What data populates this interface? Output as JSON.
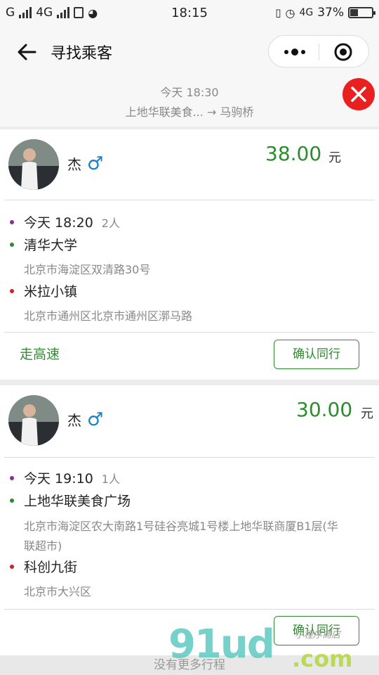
{
  "status_bar": {
    "carrier1": "G",
    "carrier2": "4G",
    "time": "18:15",
    "network": "4G",
    "battery": "37%",
    "battery_level": 0.37
  },
  "nav": {
    "title": "寻找乘客",
    "back_icon": "back-arrow-icon",
    "more_icon": "more-dots-icon",
    "close_icon": "target-circle-icon"
  },
  "trip": {
    "time": "今天 18:30",
    "route": "上地华联美食... → 马驹桥",
    "cancel_icon": "close-icon"
  },
  "passengers": [
    {
      "name": "杰",
      "gender": "♂",
      "price": "38.00",
      "unit": "元",
      "depart_time": "今天 18:20",
      "seats": "2人",
      "from_name": "清华大学",
      "from_addr": "北京市海淀区双清路30号",
      "to_name": "米拉小镇",
      "to_addr": "北京市通州区北京市通州区漷马路",
      "tag": "走高速",
      "confirm_label": "确认同行"
    },
    {
      "name": "杰",
      "gender": "♂",
      "price": "30.00",
      "unit": "元",
      "depart_time": "今天 19:10",
      "seats": "1人",
      "from_name": "上地华联美食广场",
      "from_addr_line1": "北京市海淀区农大南路1号硅谷亮城1号楼上地华联商厦B1层(华",
      "from_addr_line2": "联超市)",
      "to_name": "科创九街",
      "to_addr": "北京市大兴区",
      "confirm_label": "确认同行"
    }
  ],
  "footer": {
    "text": "没有更多行程"
  },
  "watermark": {
    "text": "91ud.com",
    "subtext": "小程序商店"
  },
  "colors": {
    "accent": "#2e8b2e",
    "danger": "#e82020",
    "male": "#1a7fc4",
    "dot_time": "#8e2a9e",
    "dot_from": "#2e8b2e",
    "dot_to": "#d42020"
  }
}
